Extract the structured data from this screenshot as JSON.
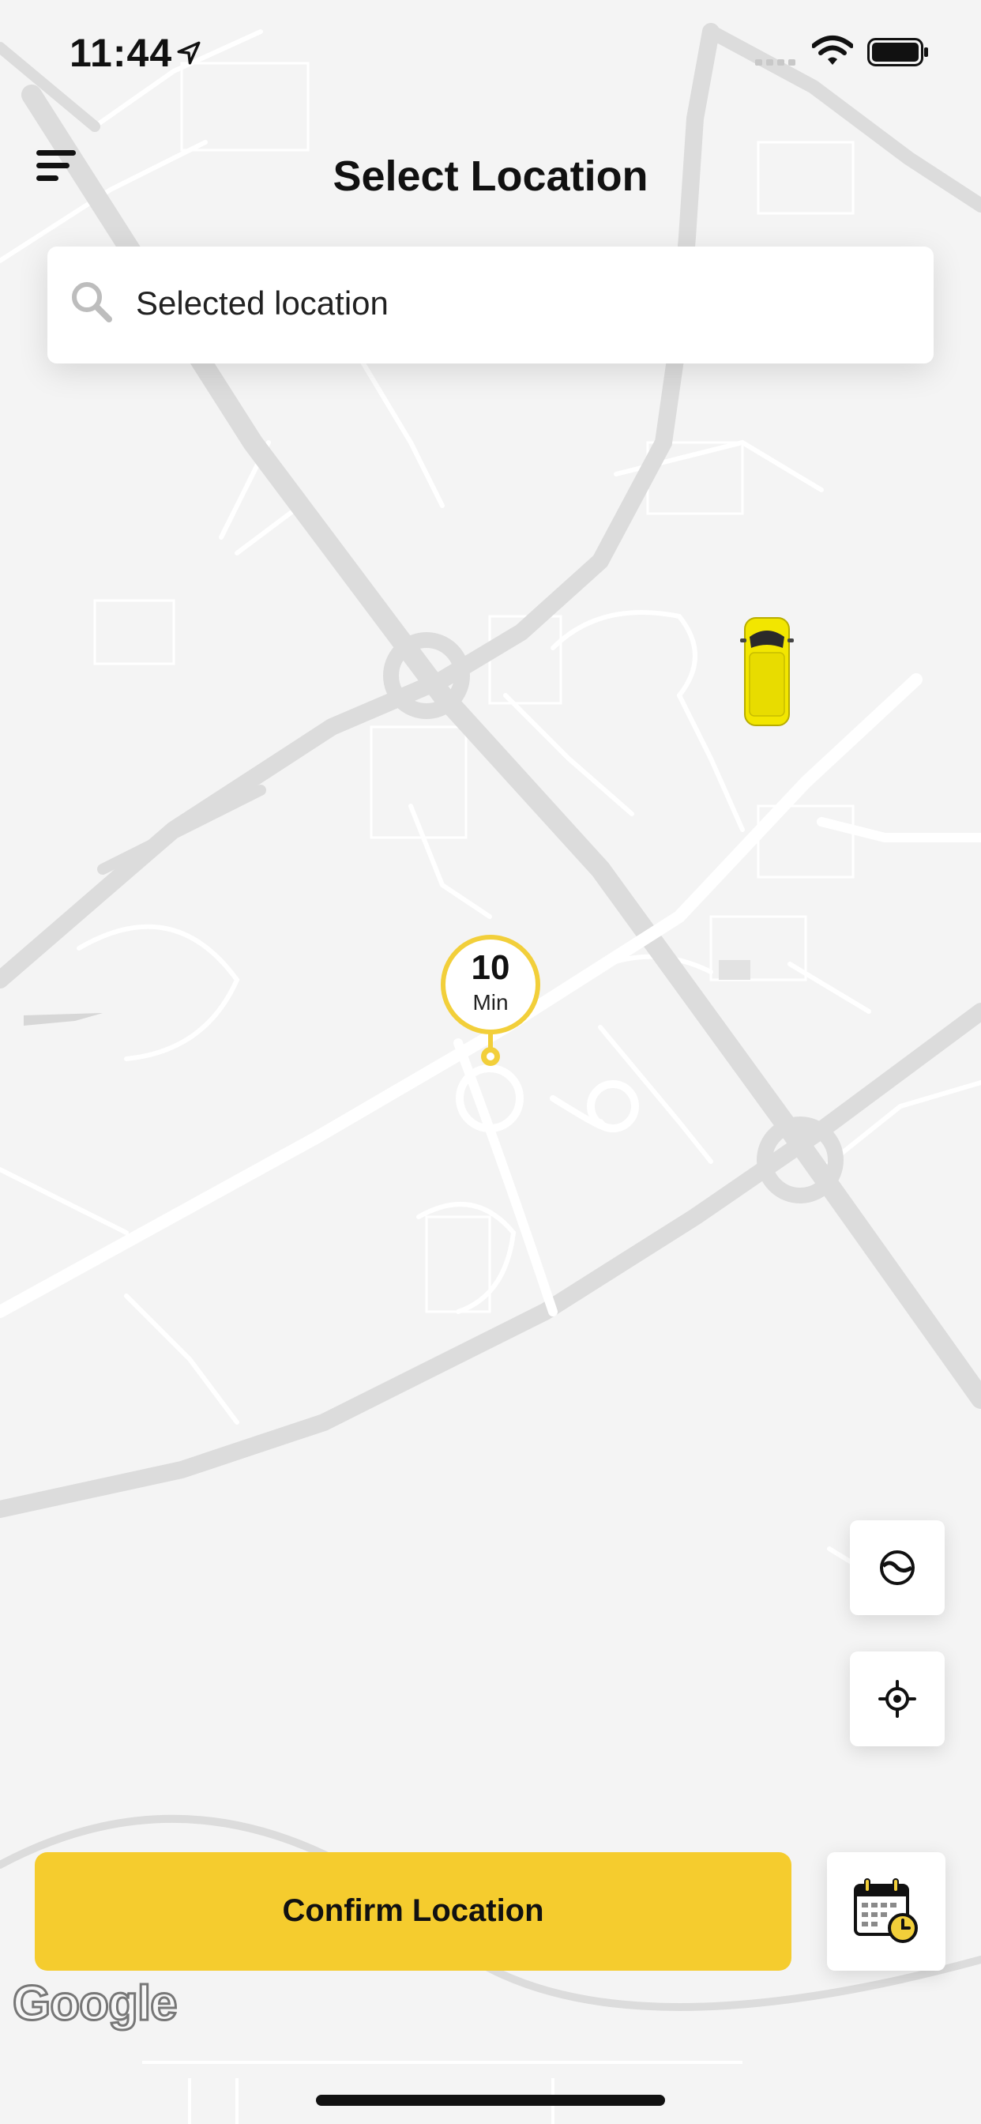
{
  "status_bar": {
    "time": "11:44"
  },
  "header": {
    "title": "Select Location"
  },
  "search": {
    "value": "Selected location"
  },
  "pickup_pin": {
    "eta_value": "10",
    "eta_unit": "Min"
  },
  "actions": {
    "confirm_label": "Confirm Location"
  },
  "map": {
    "attribution": "Google"
  },
  "colors": {
    "accent": "#f5cc2e",
    "pin": "#f2cf3a",
    "vehicle": "#f2e600"
  },
  "icons": [
    "location-arrow-icon",
    "signal-icon",
    "wifi-icon",
    "battery-icon",
    "menu-icon",
    "search-icon",
    "map-style-icon",
    "crosshair-icon",
    "calendar-clock-icon",
    "vehicle-icon"
  ]
}
